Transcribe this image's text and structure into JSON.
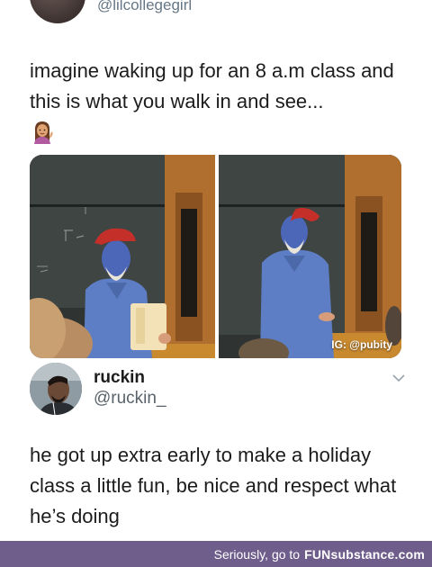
{
  "original_tweet": {
    "handle": "@lilcollegegirl",
    "text": "imagine waking up for an 8 a.m class and this is what you walk in and see...",
    "emoji": "woman-tipping-hand-emoji",
    "photo_caption": "IG: @pubity"
  },
  "reply": {
    "name": "ruckin",
    "handle": "@ruckin_",
    "text": "he got up extra early to make a holiday class a little fun, be nice and respect what he’s doing"
  },
  "footer": {
    "prefix": "Seriously, go to",
    "brand_fun": "FUN",
    "brand_rest": "substance.com",
    "bg_color": "#6f5e8c"
  }
}
